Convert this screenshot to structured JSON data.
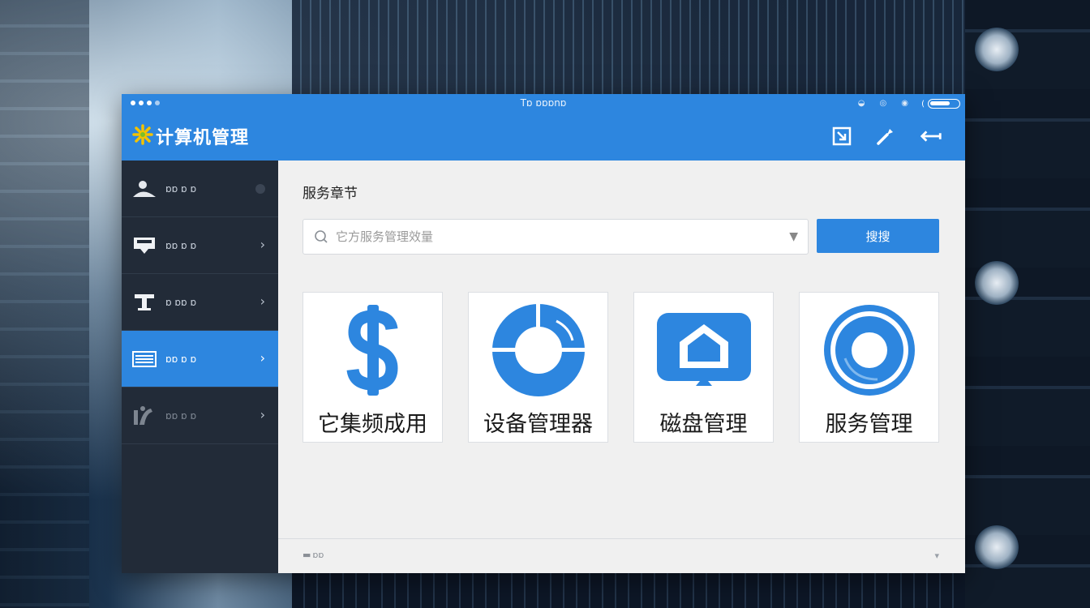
{
  "window": {
    "title": "Tɒ ɒɒɒnɒ",
    "app_title": "计算机管理"
  },
  "sidebar": {
    "items": [
      {
        "label": "ɒɒ ɒ ɒ"
      },
      {
        "label": "ɒɒ ɒ ɒ"
      },
      {
        "label": "ɒ ɒɒ ɒ"
      },
      {
        "label": "ɒɒ ɒ ɒ"
      },
      {
        "label": "ɒɒ ɒ ɒ"
      }
    ]
  },
  "main": {
    "section_title": "服务章节",
    "search": {
      "placeholder": "它方服务管理效量"
    },
    "primary_button": "搜搜",
    "cards": [
      {
        "label": "它集频成用",
        "icon": "dollar-icon"
      },
      {
        "label": "设备管理器",
        "icon": "ring-segment-icon"
      },
      {
        "label": "磁盘管理",
        "icon": "house-shield-icon"
      },
      {
        "label": "服务管理",
        "icon": "ring-icon"
      }
    ]
  },
  "footer": {
    "left_text": "ɒɒ"
  },
  "colors": {
    "accent": "#2d86df",
    "sidebar_bg": "#222b38",
    "content_bg": "#f0f0f0"
  }
}
